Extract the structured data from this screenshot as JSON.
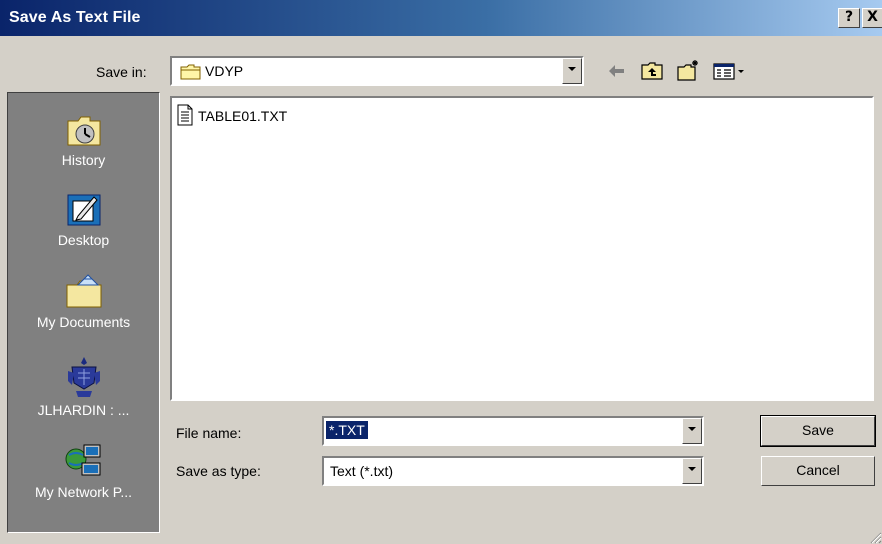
{
  "window": {
    "title": "Save As Text File",
    "help_glyph": "?",
    "close_glyph": "X"
  },
  "savein": {
    "label": "Save in:",
    "value": "VDYP"
  },
  "toolbar": {
    "icons": [
      "back-arrow-icon",
      "up-one-level-icon",
      "create-new-folder-icon",
      "view-menu-icon"
    ]
  },
  "places": {
    "items": [
      {
        "label": "History",
        "icon": "history-icon"
      },
      {
        "label": "Desktop",
        "icon": "desktop-icon"
      },
      {
        "label": "My Documents",
        "icon": "my-documents-icon"
      },
      {
        "label": "JLHARDIN : ...",
        "icon": "computer-crest-icon"
      },
      {
        "label": "My Network P...",
        "icon": "network-places-icon"
      }
    ]
  },
  "files": [
    {
      "name": "TABLE01.TXT",
      "icon": "text-file-icon"
    }
  ],
  "form": {
    "file_name_label": "File name:",
    "file_name_value": "*.TXT",
    "save_as_type_label": "Save as type:",
    "save_as_type_value": "Text (*.txt)"
  },
  "buttons": {
    "save": "Save",
    "cancel": "Cancel"
  },
  "colors": {
    "titlebar_start": "#0a246a",
    "titlebar_end": "#a6caf0",
    "dialog_face": "#d4d0c8",
    "places_bar": "#808080",
    "selection": "#0a246a"
  }
}
